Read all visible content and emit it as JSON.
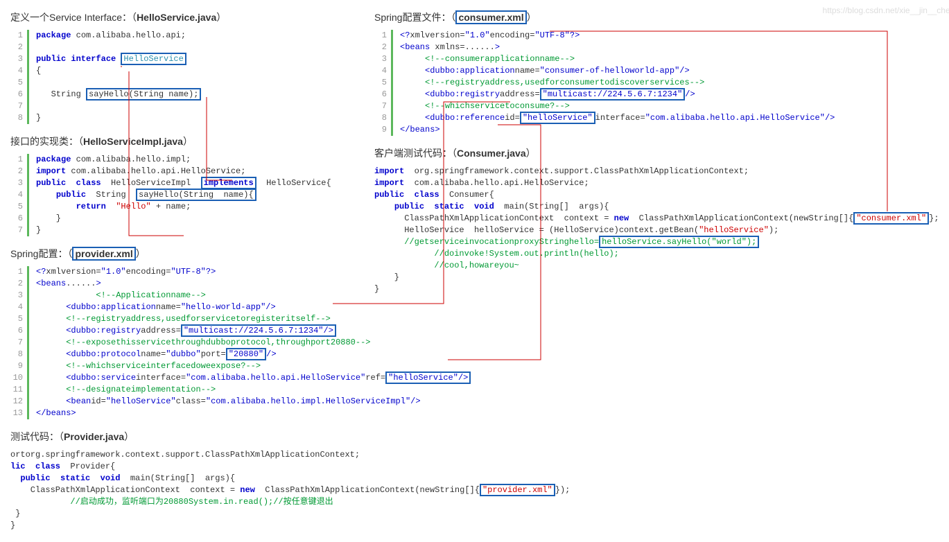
{
  "headings": {
    "h1_prefix": "定义一个Service Interface：（",
    "h1_file": "HelloService.java",
    "h1_suffix": "）",
    "h2_prefix": "接口的实现类：（",
    "h2_file": "HelloServiceImpl.java",
    "h2_suffix": "）",
    "h3_prefix": "Spring配置：（",
    "h3_file": "provider.xml",
    "h3_suffix": "）",
    "h4_prefix": "测试代码：（",
    "h4_file": "Provider.java",
    "h4_suffix": "）",
    "h5_prefix": "Spring配置文件：（",
    "h5_file": "consumer.xml",
    "h5_suffix": "）",
    "h6_prefix": "客户端测试代码：（",
    "h6_file": "Consumer.java",
    "h6_suffix": "）"
  },
  "c1": {
    "l1": "package com.alibaba.hello.api;",
    "l2": "",
    "l3a": "public interface ",
    "l3b": "HelloService",
    "l4": "{",
    "l5": "",
    "l6a": "   String ",
    "l6b": "sayHello(String name);",
    "l7": "",
    "l8": "}"
  },
  "c2": {
    "l1": "package com.alibaba.hello.impl;",
    "l2a": "import ",
    "l2b": "com.alibaba.hello.api.HelloService;",
    "l3a": "public  class  ",
    "l3b": "HelloServiceImpl  ",
    "l3c": "implements",
    "l3d": "  HelloService{",
    "l4a": "    public  ",
    "l4b": "String  ",
    "l4c": "sayHello(String  name){",
    "l5a": "        return  ",
    "l5b": "\"Hello\"",
    "l5c": " + name;",
    "l6": "    }",
    "l7": "}"
  },
  "c3": {
    "l1": "<?xmlversion=\"1.0\"encoding=\"UTF-8\"?>",
    "l2": "<beans......>",
    "l3": "      <!--Applicationname-->",
    "l4a": "      <dubbo:applicationname=",
    "l4b": "\"hello-world-app\"",
    "l4c": "/>",
    "l5": "      <!--registryaddress,usedforservicetoregisteritself-->",
    "l6a": "      <dubbo:registryaddress=",
    "l6b": "\"multicast://224.5.6.7:1234\"",
    "l6c": "/>",
    "l7": "      <!--exposethisservicethroughdubboprotocol,throughport20880-->",
    "l8a": "      <dubbo:protocolname=",
    "l8b": "\"dubbo\"",
    "l8c": "port=",
    "l8d": "\"20880\"",
    "l8e": "/>",
    "l9": "      <!--whichserviceinterfacedoweexpose?-->",
    "l10a": "      <dubbo:serviceinterface=",
    "l10b": "\"com.alibaba.hello.api.HelloService\"",
    "l10c": "ref=",
    "l10d": "\"helloService\"",
    "l10e": "/>",
    "l11": "      <!--designateimplementation-->",
    "l12a": "      <beanid=",
    "l12b": "\"helloService\"",
    "l12c": "class=",
    "l12d": "\"com.alibaba.hello.impl.HelloServiceImpl\"",
    "l12e": "/>",
    "l13": "</beans>"
  },
  "c4": {
    "l1": "ortorg.springframework.context.support.ClassPathXmlApplicationContext;",
    "l2": "lic  class  Provider{",
    "l3a": "  public  static  void  ",
    "l3b": "main(String[]  args){",
    "l4a": "    ClassPathXmlApplicationContext  context = ",
    "l4b": "new",
    "l4c": "  ClassPathXmlApplicationContext(newString[]{",
    "l4d": "\"provider.xml\"",
    "l4e": "});",
    "l5": "      //启动成功，监听端口为20880System.in.read();//按任意键退出",
    "l6": " }",
    "l7": "}"
  },
  "c5": {
    "l1": "<?xmlversion=\"1.0\"encoding=\"UTF-8\"?>",
    "l2": "<beans xmlns=......>",
    "l3": "     <!--consumerapplicationname-->",
    "l4a": "     <dubbo:applicationname=",
    "l4b": "\"consumer-of-helloworld-app\"",
    "l4c": "/>",
    "l5": "     <!--registryaddress,usedforconsumertodiscoverservices-->",
    "l6a": "     <dubbo:registryaddress=",
    "l6b": "\"multicast://224.5.6.7:1234\"",
    "l6c": "/>",
    "l7": "     <!--whichservicetoconsume?-->",
    "l8a": "     <dubbo:referenceid=",
    "l8b": "\"helloService\"",
    "l8c": "interface=",
    "l8d": "\"com.alibaba.hello.api.HelloService\"",
    "l8e": "/>",
    "l9": "</beans>"
  },
  "c6": {
    "l1a": "import  ",
    "l1b": "org.springframework.context.support.ClassPathXmlApplicationContext;",
    "l2a": "import  ",
    "l2b": "com.alibaba.hello.api.HelloService;",
    "l3": "public  class  Consumer{",
    "l4a": "    public  static  void  ",
    "l4b": "main(String[]  args){",
    "l5a": "      ClassPathXmlApplicationContext  context = ",
    "l5b": "new",
    "l5c": "  ClassPathXmlApplicationContext(newString[]{",
    "l5d": "\"consumer.xml\"",
    "l5e": "};",
    "l6a": "      HelloService  helloService = (HelloService)context.getBean(",
    "l6b": "\"helloService\"",
    "l6c": ");",
    "l7a": "      //getserviceinvocationproxyStringhello=",
    "l7b": "helloService.sayHello(\"world\");",
    "l8": "      //doinvoke!System.out.println(hello);",
    "l9": "      //cool,howareyou~",
    "l10": "    }",
    "l11": "}"
  },
  "watermark": "https://blog.csdn.net/xie__jin__cheng"
}
